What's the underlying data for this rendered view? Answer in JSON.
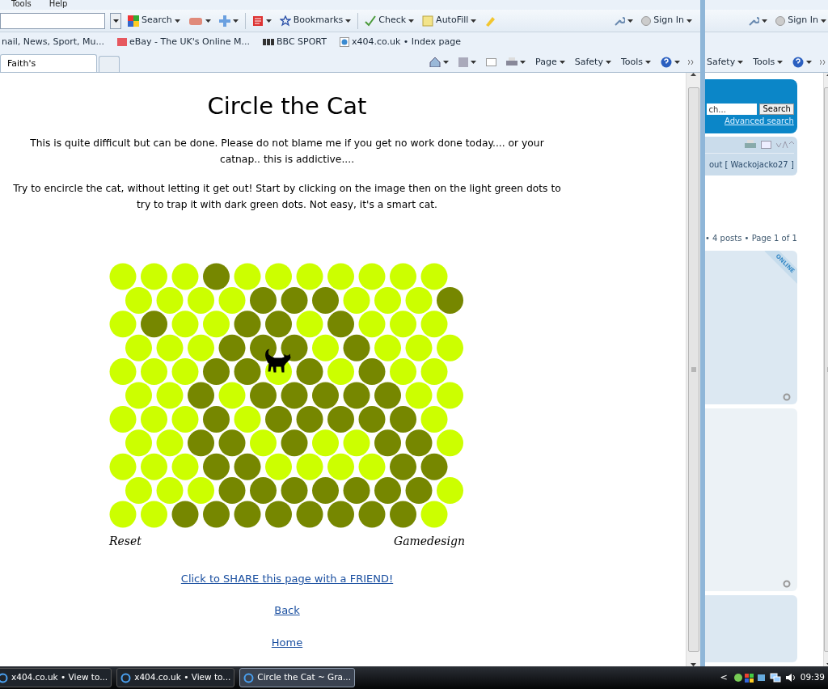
{
  "menu_bar": [
    "Tools",
    "Help"
  ],
  "toolbar": {
    "search_label": "Search",
    "bookmarks_label": "Bookmarks",
    "check_label": "Check",
    "autofill_label": "AutoFill",
    "sign_in_label": "Sign In"
  },
  "favorites": [
    {
      "label": "nail, News, Sport, Mu...",
      "kind": "plain"
    },
    {
      "label": "eBay - The UK's Online M...",
      "kind": "ebay"
    },
    {
      "label": "BBC SPORT",
      "kind": "bbc"
    },
    {
      "label": "x404.co.uk • Index page",
      "kind": "page"
    }
  ],
  "tabs": [
    {
      "label": "Faith's",
      "selected": true
    }
  ],
  "command_bar": [
    "Page",
    "Safety",
    "Tools"
  ],
  "page": {
    "title": "Circle the Cat",
    "paragraphs": [
      "This is quite difficult but can be done. Please do not blame me if you get no work done today.... or your catnap.. this is addictive....",
      "Try to encircle the cat, without letting it get out! Start by clicking on the image then on the light green dots to try to trap it with dark green dots. Not easy, it's a smart cat."
    ],
    "board": {
      "rows": [
        [
          {
            "blocked": false,
            "cat": false
          },
          {
            "blocked": false,
            "cat": false
          },
          {
            "blocked": false,
            "cat": false
          },
          {
            "blocked": true,
            "cat": false
          },
          {
            "blocked": false,
            "cat": false
          },
          {
            "blocked": false,
            "cat": false
          },
          {
            "blocked": false,
            "cat": false
          },
          {
            "blocked": false,
            "cat": false
          },
          {
            "blocked": false,
            "cat": false
          },
          {
            "blocked": false,
            "cat": false
          },
          {
            "blocked": false,
            "cat": false
          }
        ],
        [
          {
            "blocked": false,
            "cat": false
          },
          {
            "blocked": false,
            "cat": false
          },
          {
            "blocked": false,
            "cat": false
          },
          {
            "blocked": false,
            "cat": false
          },
          {
            "blocked": true,
            "cat": false
          },
          {
            "blocked": true,
            "cat": false
          },
          {
            "blocked": true,
            "cat": false
          },
          {
            "blocked": false,
            "cat": false
          },
          {
            "blocked": false,
            "cat": false
          },
          {
            "blocked": false,
            "cat": false
          },
          {
            "blocked": true,
            "cat": false
          }
        ],
        [
          {
            "blocked": false,
            "cat": false
          },
          {
            "blocked": true,
            "cat": false
          },
          {
            "blocked": false,
            "cat": false
          },
          {
            "blocked": false,
            "cat": false
          },
          {
            "blocked": true,
            "cat": false
          },
          {
            "blocked": true,
            "cat": false
          },
          {
            "blocked": false,
            "cat": false
          },
          {
            "blocked": true,
            "cat": false
          },
          {
            "blocked": false,
            "cat": false
          },
          {
            "blocked": false,
            "cat": false
          },
          {
            "blocked": false,
            "cat": false
          }
        ],
        [
          {
            "blocked": false,
            "cat": false
          },
          {
            "blocked": false,
            "cat": false
          },
          {
            "blocked": false,
            "cat": false
          },
          {
            "blocked": true,
            "cat": false
          },
          {
            "blocked": true,
            "cat": false
          },
          {
            "blocked": true,
            "cat": false
          },
          {
            "blocked": false,
            "cat": false
          },
          {
            "blocked": true,
            "cat": false
          },
          {
            "blocked": false,
            "cat": false
          },
          {
            "blocked": false,
            "cat": false
          },
          {
            "blocked": false,
            "cat": false
          }
        ],
        [
          {
            "blocked": false,
            "cat": false
          },
          {
            "blocked": false,
            "cat": false
          },
          {
            "blocked": false,
            "cat": false
          },
          {
            "blocked": true,
            "cat": false
          },
          {
            "blocked": true,
            "cat": false
          },
          {
            "blocked": false,
            "cat": true
          },
          {
            "blocked": true,
            "cat": false
          },
          {
            "blocked": false,
            "cat": false
          },
          {
            "blocked": true,
            "cat": false
          },
          {
            "blocked": false,
            "cat": false
          },
          {
            "blocked": false,
            "cat": false
          }
        ],
        [
          {
            "blocked": false,
            "cat": false
          },
          {
            "blocked": false,
            "cat": false
          },
          {
            "blocked": true,
            "cat": false
          },
          {
            "blocked": false,
            "cat": false
          },
          {
            "blocked": true,
            "cat": false
          },
          {
            "blocked": true,
            "cat": false
          },
          {
            "blocked": true,
            "cat": false
          },
          {
            "blocked": true,
            "cat": false
          },
          {
            "blocked": true,
            "cat": false
          },
          {
            "blocked": false,
            "cat": false
          },
          {
            "blocked": false,
            "cat": false
          }
        ],
        [
          {
            "blocked": false,
            "cat": false
          },
          {
            "blocked": false,
            "cat": false
          },
          {
            "blocked": false,
            "cat": false
          },
          {
            "blocked": true,
            "cat": false
          },
          {
            "blocked": false,
            "cat": false
          },
          {
            "blocked": true,
            "cat": false
          },
          {
            "blocked": true,
            "cat": false
          },
          {
            "blocked": true,
            "cat": false
          },
          {
            "blocked": true,
            "cat": false
          },
          {
            "blocked": true,
            "cat": false
          },
          {
            "blocked": false,
            "cat": false
          }
        ],
        [
          {
            "blocked": false,
            "cat": false
          },
          {
            "blocked": false,
            "cat": false
          },
          {
            "blocked": true,
            "cat": false
          },
          {
            "blocked": true,
            "cat": false
          },
          {
            "blocked": false,
            "cat": false
          },
          {
            "blocked": true,
            "cat": false
          },
          {
            "blocked": false,
            "cat": false
          },
          {
            "blocked": false,
            "cat": false
          },
          {
            "blocked": true,
            "cat": false
          },
          {
            "blocked": true,
            "cat": false
          },
          {
            "blocked": false,
            "cat": false
          }
        ],
        [
          {
            "blocked": false,
            "cat": false
          },
          {
            "blocked": false,
            "cat": false
          },
          {
            "blocked": false,
            "cat": false
          },
          {
            "blocked": true,
            "cat": false
          },
          {
            "blocked": true,
            "cat": false
          },
          {
            "blocked": false,
            "cat": false
          },
          {
            "blocked": false,
            "cat": false
          },
          {
            "blocked": false,
            "cat": false
          },
          {
            "blocked": false,
            "cat": false
          },
          {
            "blocked": true,
            "cat": false
          },
          {
            "blocked": true,
            "cat": false
          }
        ],
        [
          {
            "blocked": false,
            "cat": false
          },
          {
            "blocked": false,
            "cat": false
          },
          {
            "blocked": false,
            "cat": false
          },
          {
            "blocked": true,
            "cat": false
          },
          {
            "blocked": true,
            "cat": false
          },
          {
            "blocked": true,
            "cat": false
          },
          {
            "blocked": true,
            "cat": false
          },
          {
            "blocked": true,
            "cat": false
          },
          {
            "blocked": true,
            "cat": false
          },
          {
            "blocked": true,
            "cat": false
          },
          {
            "blocked": false,
            "cat": false
          }
        ],
        [
          {
            "blocked": false,
            "cat": false
          },
          {
            "blocked": false,
            "cat": false
          },
          {
            "blocked": true,
            "cat": false
          },
          {
            "blocked": true,
            "cat": false
          },
          {
            "blocked": true,
            "cat": false
          },
          {
            "blocked": true,
            "cat": false
          },
          {
            "blocked": true,
            "cat": false
          },
          {
            "blocked": true,
            "cat": false
          },
          {
            "blocked": true,
            "cat": false
          },
          {
            "blocked": true,
            "cat": false
          },
          {
            "blocked": false,
            "cat": false
          }
        ]
      ],
      "reset_label": "Reset",
      "credit_label": "Gamedesign"
    },
    "links": [
      "Click to SHARE this page with a FRIEND!",
      "Back",
      "Home"
    ]
  },
  "background_window": {
    "sign_in_label": "Sign In",
    "command_bar": [
      "Safety",
      "Tools"
    ],
    "search_placeholder": "ch...",
    "search_button": "Search",
    "advanced_search": "Advanced search",
    "user_text": "out [ Wackojacko27 ]",
    "pagination": "• 4 posts • Page 1 of 1",
    "online_badge": "ONLINE"
  },
  "taskbar": {
    "items": [
      {
        "label": "x404.co.uk • View to...",
        "selected": false
      },
      {
        "label": "x404.co.uk • View to...",
        "selected": false
      },
      {
        "label": "Circle the Cat ~ Gra...",
        "selected": true
      }
    ],
    "tray_arrow": "<",
    "clock": "09:39"
  }
}
